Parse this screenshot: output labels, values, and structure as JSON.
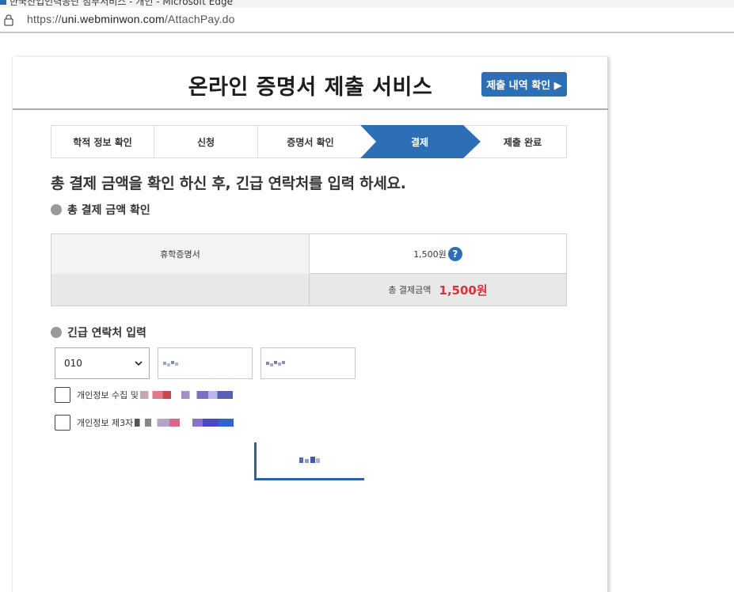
{
  "browser": {
    "window_title": "한국산업인력공단 첨부서비스 - 개인 - Microsoft Edge",
    "url_host": "uni.webminwon.com",
    "url_path": "/AttachPay.do",
    "url_scheme": "https://"
  },
  "header": {
    "title": "온라인 증명서 제출 서비스",
    "history_button": "제출 내역 확인 ▶"
  },
  "steps": [
    {
      "label": "학적 정보 확인",
      "active": false
    },
    {
      "label": "신청",
      "active": false
    },
    {
      "label": "증명서 확인",
      "active": false
    },
    {
      "label": "결제",
      "active": true
    },
    {
      "label": "제출 완료",
      "active": false
    }
  ],
  "instruction": "총 결제 금액을 확인 하신 후, 긴급 연락처를 입력 하세요.",
  "amount_section": {
    "heading": "총 결제 금액 확인",
    "item_name": "휴학증명서",
    "item_price": "1,500원",
    "total_label": "총 결제금액",
    "total_value": "1,500원"
  },
  "contact_section": {
    "heading": "긴급 연락처 입력",
    "prefix_selected": "010"
  },
  "agreements": [
    {
      "label": "개인정보 수집 및"
    },
    {
      "label": "개인정보 제3자"
    }
  ],
  "colors": {
    "accent": "#2d6fb7",
    "total_amount": "#d43535",
    "section_dot": "#9a9a9a"
  },
  "icons": {
    "help": "question-circle-icon",
    "lock": "lock-icon",
    "chevron": "chevron-down-icon"
  }
}
